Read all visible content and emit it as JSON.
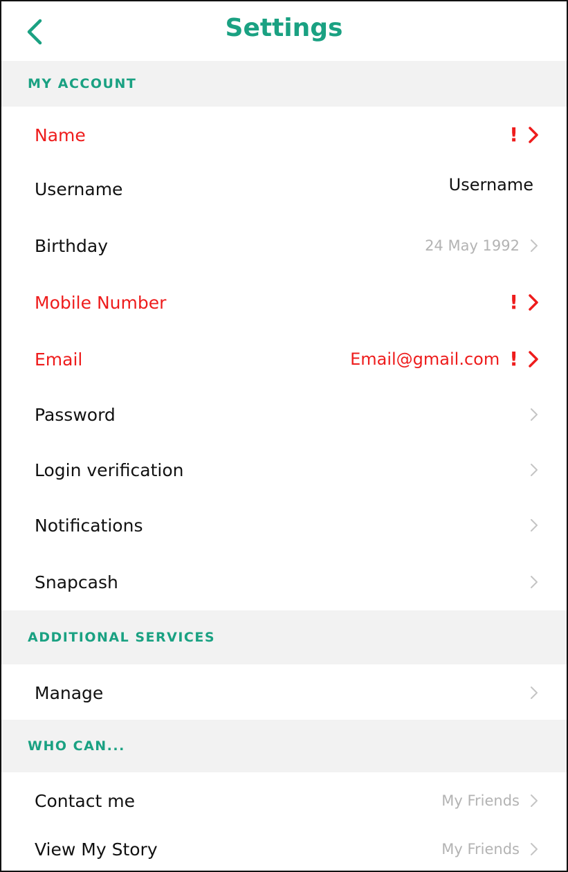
{
  "header": {
    "title": "Settings",
    "back_icon": "chevron-left-icon"
  },
  "colors": {
    "accent": "#1aa182",
    "alert": "#ee1c1c",
    "muted": "#b3b3b3",
    "section_bg": "#f2f2f2"
  },
  "sections": {
    "my_account": {
      "title": "MY ACCOUNT",
      "rows": {
        "name": {
          "label": "Name",
          "alert": true
        },
        "username": {
          "label": "Username",
          "value": "Username"
        },
        "birthday": {
          "label": "Birthday",
          "value": "24 May 1992"
        },
        "mobile": {
          "label": "Mobile Number",
          "alert": true
        },
        "email": {
          "label": "Email",
          "value": "Email@gmail.com",
          "alert": true
        },
        "password": {
          "label": "Password"
        },
        "login_verification": {
          "label": "Login verification"
        },
        "notifications": {
          "label": "Notifications"
        },
        "snapcash": {
          "label": "Snapcash"
        }
      }
    },
    "additional_services": {
      "title": "ADDITIONAL SERVICES",
      "rows": {
        "manage": {
          "label": "Manage"
        }
      }
    },
    "who_can": {
      "title": "WHO CAN...",
      "rows": {
        "contact_me": {
          "label": "Contact me",
          "value": "My Friends"
        },
        "view_my_story": {
          "label": "View My Story",
          "value": "My Friends"
        }
      }
    }
  },
  "alert_symbol": "!"
}
